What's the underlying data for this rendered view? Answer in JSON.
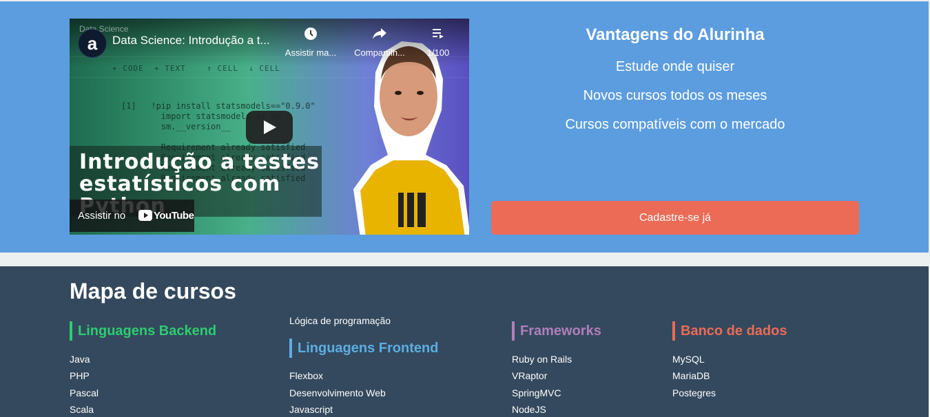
{
  "video": {
    "channel_letter": "a",
    "ghost_label": "Data Science",
    "title": "Data Science: Introdução a t...",
    "watch_later": "Assistir ma...",
    "share": "Compartilh...",
    "playlist": "1/100",
    "overlay_line1": "Introdução a testes",
    "overlay_line2": "estatísticos com",
    "overlay_line3": "Python",
    "watch_on": "Assistir no",
    "youtube": "YouTube",
    "notebook_toolbar": "+ CODE  + TEXT    ↑ CELL  ↓ CELL",
    "code_text": "[1]   !pip install statsmodels==\"0.9.0\"\n        import statsmodels as sm\n        sm.__version__\n\n        Requirement already satisfied\n        Requirement already satisfied\n        Requirement already satisfied\n        Requirement already satisfied"
  },
  "advantages": {
    "title": "Vantagens do Alurinha",
    "items": [
      "Estude onde quiser",
      "Novos cursos todos os meses",
      "Cursos compatíveis com o mercado"
    ]
  },
  "cta": {
    "label": "Cadastre-se já"
  },
  "course_map": {
    "title": "Mapa de cursos",
    "backend": {
      "title": "Linguagens Backend",
      "items": [
        "Java",
        "PHP",
        "Pascal",
        "Scala"
      ]
    },
    "logic_link": "Lógica de programação",
    "frontend": {
      "title": "Linguagens Frontend",
      "items": [
        "Flexbox",
        "Desenvolvimento Web",
        "Javascript"
      ]
    },
    "frameworks": {
      "title": "Frameworks",
      "items": [
        "Ruby on Rails",
        "VRaptor",
        "SpringMVC",
        "NodeJS"
      ]
    },
    "databases": {
      "title": "Banco de dados",
      "items": [
        "MySQL",
        "MariaDB",
        "Postegres"
      ]
    }
  },
  "colors": {
    "hero_bg": "#5c9ddf",
    "footer_bg": "#34495e",
    "cta": "#eb6b56",
    "backend": "#2ecc71",
    "frontend": "#5dade2",
    "frameworks": "#b07fba",
    "databases": "#eb6b56"
  }
}
